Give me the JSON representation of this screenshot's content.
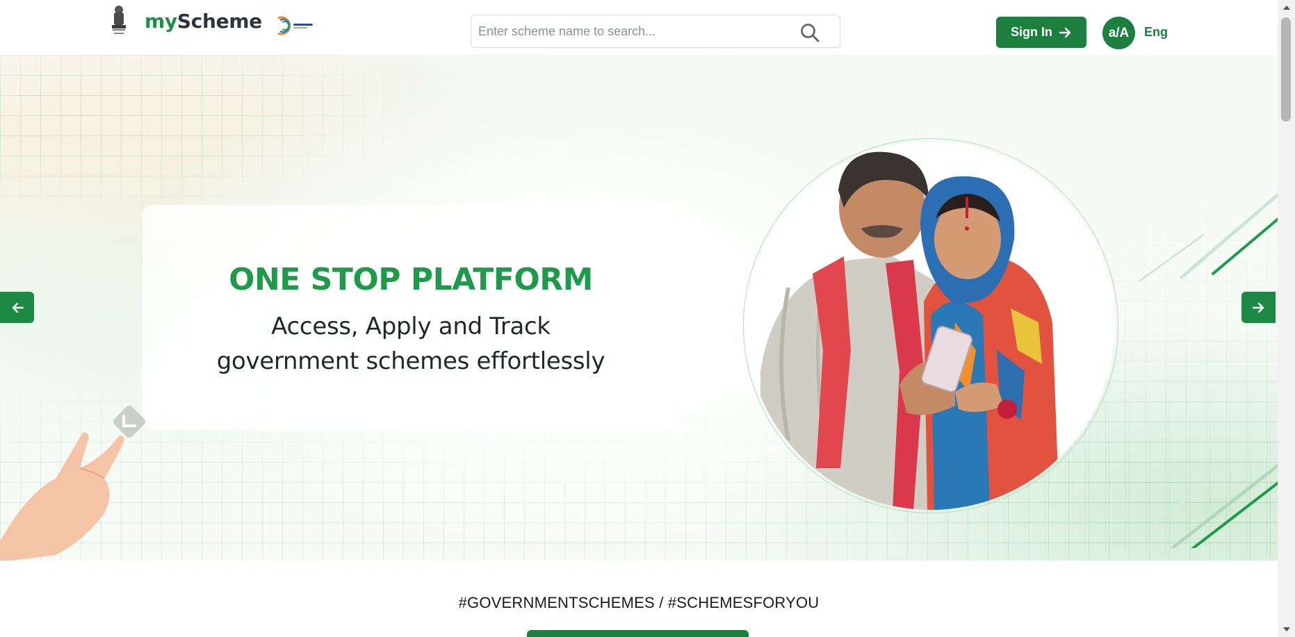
{
  "header": {
    "brand_my": "my",
    "brand_scheme": "Scheme",
    "search_placeholder": "Enter scheme name to search...",
    "signin_label": "Sign In",
    "font_toggle_label": "a/A",
    "language_label": "Eng",
    "icons": [
      "national-emblem-icon",
      "digital-india-logo",
      "search-icon",
      "arrow-right-icon"
    ]
  },
  "hero": {
    "heading": "ONE STOP PLATFORM",
    "subheading_line1": "Access, Apply and Track",
    "subheading_line2": "government schemes effortlessly",
    "prev_icon": "arrow-left-icon",
    "next_icon": "arrow-right-icon"
  },
  "section": {
    "hashtags": "#GOVERNMENTSCHEMES / #SCHEMESFORYOU"
  },
  "colors": {
    "brand_green": "#1c7f3e",
    "heading_green": "#1e9a4a",
    "text_dark": "#1d2a24"
  }
}
